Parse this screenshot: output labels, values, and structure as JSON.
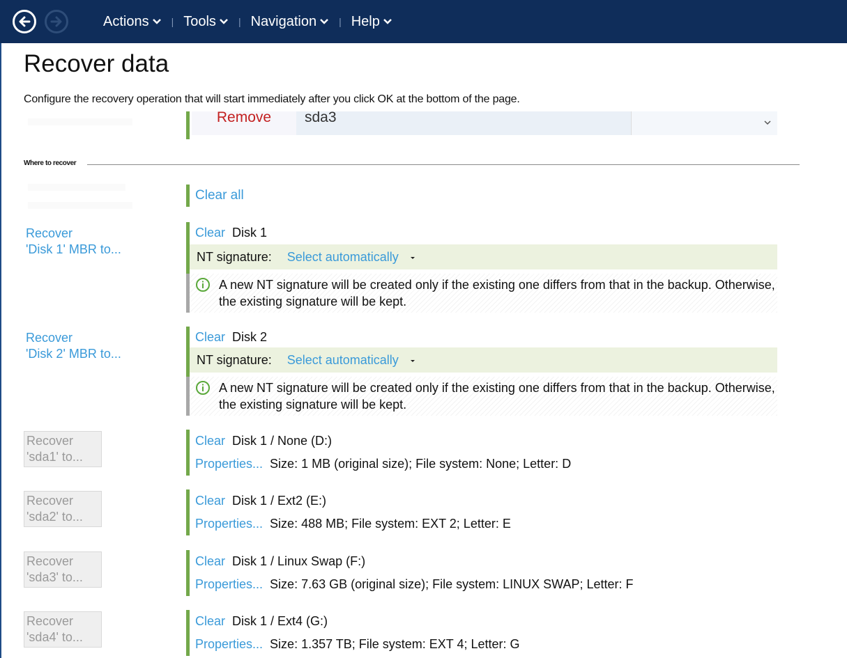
{
  "topbar": {
    "menu": [
      "Actions",
      "Tools",
      "Navigation",
      "Help"
    ],
    "colors": {
      "bar": "#0f2d5a",
      "text": "#ffffff"
    }
  },
  "page": {
    "title": "Recover data",
    "subtitle": "Configure the recovery operation that will start immediately after you click OK at the bottom of the page."
  },
  "remove_row": {
    "action": "Remove",
    "value": "sda3"
  },
  "section": {
    "label": "Where to recover"
  },
  "clear_all": "Clear all",
  "clear_label": "Clear",
  "properties_label": "Properties...",
  "mbr_targets": [
    {
      "left_line1": "Recover",
      "left_line2": "'Disk 1' MBR to...",
      "disk": "Disk 1",
      "nt_label": "NT signature:",
      "nt_value": "Select automatically",
      "info": "A new NT signature will be created only if the existing one differs from that in the backup. Otherwise, the existing signature will be kept."
    },
    {
      "left_line1": "Recover",
      "left_line2": "'Disk 2' MBR to...",
      "disk": "Disk 2",
      "nt_label": "NT signature:",
      "nt_value": "Select automatically",
      "info": "A new NT signature will be created only if the existing one differs from that in the backup. Otherwise, the existing signature will be kept."
    }
  ],
  "partition_targets": [
    {
      "left_line1": "Recover",
      "left_line2": "'sda1' to...",
      "target": "Disk 1 / None (D:)",
      "details": "Size: 1 MB (original size); File system: None; Letter: D"
    },
    {
      "left_line1": "Recover",
      "left_line2": "'sda2' to...",
      "target": "Disk 1 / Ext2 (E:)",
      "details": "Size: 488 MB; File system: EXT 2; Letter: E"
    },
    {
      "left_line1": "Recover",
      "left_line2": "'sda3' to...",
      "target": "Disk 1 / Linux Swap (F:)",
      "details": "Size: 7.63 GB (original size); File system: LINUX SWAP; Letter: F"
    },
    {
      "left_line1": "Recover",
      "left_line2": "'sda4' to...",
      "target": "Disk 1 / Ext4 (G:)",
      "details": "Size: 1.357 TB; File system: EXT 4; Letter: G"
    }
  ]
}
